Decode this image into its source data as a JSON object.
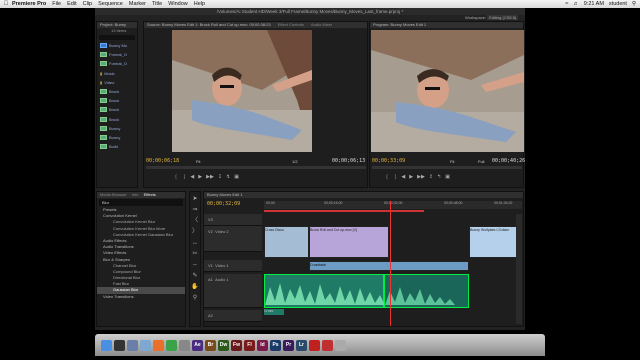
{
  "menubar": {
    "app_name": "Premiere Pro",
    "items": [
      "File",
      "Edit",
      "Clip",
      "Sequence",
      "Marker",
      "Title",
      "Window",
      "Help"
    ],
    "time": "9:21 AM",
    "user": "student"
  },
  "window": {
    "path": "/Volumes/Ai Student HD/Week 3/Full Frame/Bunny Moves/Bunny_Moves_Last_frame.prproj *",
    "workspace_label": "Workspace:",
    "workspace_value": "Editing (CS5.5)"
  },
  "project": {
    "tab": "Project: Bunny",
    "count": "13 Items",
    "items": [
      "Bunny Mo",
      "Format_O",
      "Format_O",
      "Music",
      "Video",
      "Brock",
      "Brock",
      "Brock",
      "Brock",
      "Bunny",
      "Bunny",
      "Build"
    ]
  },
  "source": {
    "tab": "Source: Bunny Moves Edit 1: Brock Roll and Cut up.mov: 00:00:38:23",
    "tab2": "Effect Controls",
    "tab3": "Audio Mixer",
    "timecode": "00;00;06;18",
    "fit": "Fit",
    "duration": "00;00;06;13",
    "scale": "1/2"
  },
  "program": {
    "tab": "Program: Bunny Moves Edit 1",
    "timecode": "00;00;33;09",
    "fit": "Fit",
    "duration": "00;00;40;26",
    "scale": "Full"
  },
  "effects": {
    "tabs": [
      "Media Browser",
      "Info",
      "Effects"
    ],
    "search": "Blur",
    "rows": [
      {
        "label": "Presets",
        "level": 0
      },
      {
        "label": "Convolution Kernel",
        "level": 0
      },
      {
        "label": "Convolution Kernel Blur",
        "level": 1
      },
      {
        "label": "Convolution Kernel Blur More",
        "level": 1
      },
      {
        "label": "Convolution Kernel Gaussian Blur",
        "level": 1
      },
      {
        "label": "Audio Effects",
        "level": 0
      },
      {
        "label": "Audio Transitions",
        "level": 0
      },
      {
        "label": "Video Effects",
        "level": 0
      },
      {
        "label": "Blur & Sharpen",
        "level": 0
      },
      {
        "label": "Channel Blur",
        "level": 1
      },
      {
        "label": "Compound Blur",
        "level": 1
      },
      {
        "label": "Directional Blur",
        "level": 1
      },
      {
        "label": "Fast Blur",
        "level": 1
      },
      {
        "label": "Gaussian Blur",
        "level": 1
      },
      {
        "label": "Video Transitions",
        "level": 0
      }
    ]
  },
  "timeline": {
    "tab": "Bunny Moves Edit 1",
    "timecode": "00;00;32;09",
    "ticks": [
      "00;00",
      "00;00;16;00",
      "00;00;32;00",
      "00;00;48;00",
      "00;01;04;02"
    ],
    "tracks": [
      "Video 3",
      "Video 2",
      "Video 1",
      "Audio 1",
      "Audio 2",
      "Audio 3"
    ],
    "track_ids": [
      "V3",
      "V2",
      "V1",
      "A1",
      "A2",
      "A3"
    ],
    "clips": [
      "Cross Disso",
      "Brock Roll and Cut up.mov [V]",
      "Bunny Wolfplate.CGdiam",
      "Crossfade",
      "Cross"
    ]
  },
  "dock": {
    "icons": [
      "Finder",
      "Dashboard",
      "Mission Control",
      "Mail",
      "Firefox",
      "Chrome",
      "Sys Pref",
      "Ae",
      "Br",
      "Dw",
      "Fw",
      "Fl",
      "Id",
      "Ps",
      "Pr",
      "Lr",
      "Acrobat",
      "Stop",
      "Trash"
    ],
    "colors": [
      "#4a90e2",
      "#333333",
      "#6a7fa8",
      "#7fa8d0",
      "#e8702a",
      "#3ca24a",
      "#888888",
      "#4b2b7f",
      "#7a4b1a",
      "#2b5a1a",
      "#6a1a1a",
      "#7a1a1a",
      "#7a1a4b",
      "#1a3a6a",
      "#3a1a5a",
      "#2a4a6a",
      "#c02020",
      "#c03030",
      "#aaaaaa"
    ]
  }
}
